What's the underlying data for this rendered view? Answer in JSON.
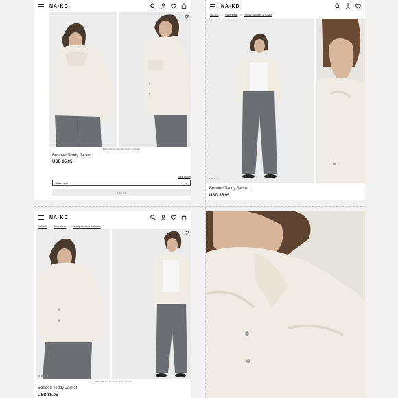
{
  "brand": "NA-KD",
  "breadcrumb": [
    "NA-KD",
    "Outerwear",
    "Teddy Jackets & Coats"
  ],
  "product": {
    "title": "Bonded Teddy Jacket",
    "price": "USD 85.95",
    "model_info": "Model 175 cm | EU 36 / M | 24 & 34/xtall",
    "size_guide_label": "Size guide",
    "select_size_label": "Select size",
    "sold_out_label": "Sold out"
  },
  "icons": [
    "menu-icon",
    "search-icon",
    "user-icon",
    "heart-icon",
    "bag-icon"
  ],
  "colors": {
    "jacket": "#f1ece3",
    "jeans": "#6b6e73",
    "background": "#f2f2f2"
  }
}
